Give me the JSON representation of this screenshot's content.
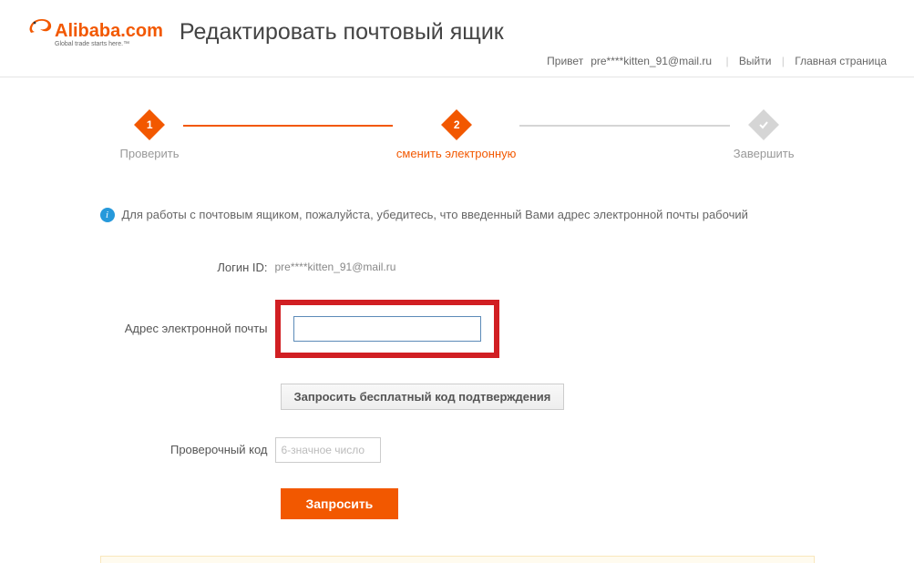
{
  "logo": {
    "main": "Alibaba.com",
    "sub": "Global trade starts here.™"
  },
  "page_title": "Редактировать почтовый ящик",
  "topbar": {
    "greeting_prefix": "Привет",
    "user_email": "pre****kitten_91@mail.ru",
    "logout": "Выйти",
    "home": "Главная страница"
  },
  "steps": {
    "step1": {
      "num": "1",
      "label": "Проверить"
    },
    "step2": {
      "num": "2",
      "label": "сменить электронную"
    },
    "step3": {
      "label": "Завершить"
    }
  },
  "info_text": "Для работы с почтовым ящиком, пожалуйста, убедитесь, что введенный Вами адрес электронной почты рабочий",
  "form": {
    "login_id_label": "Логин ID:",
    "login_id_value": "pre****kitten_91@mail.ru",
    "email_label": "Адрес электронной почты",
    "request_code_btn": "Запросить бесплатный код подтверждения",
    "verify_label": "Проверочный код",
    "verify_placeholder": "6-значное число",
    "submit_btn": "Запросить"
  }
}
